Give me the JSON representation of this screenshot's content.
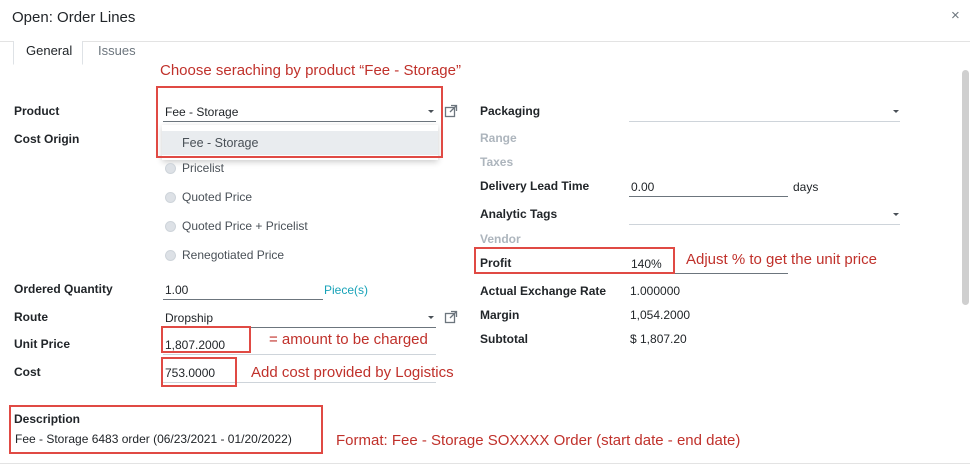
{
  "dialog": {
    "title": "Open: Order Lines",
    "close_symbol": "×"
  },
  "tabs": [
    {
      "label": "General"
    },
    {
      "label": "Issues"
    }
  ],
  "left": {
    "product_label": "Product",
    "product_value": "Fee - Storage",
    "product_option": "Fee - Storage",
    "cost_origin_label": "Cost Origin",
    "cost_origin_options": [
      "Pricelist",
      "Quoted Price",
      "Quoted Price + Pricelist",
      "Renegotiated Price"
    ],
    "ordered_qty_label": "Ordered Quantity",
    "ordered_qty_value": "1.00",
    "uom_value": "Piece(s)",
    "route_label": "Route",
    "route_value": "Dropship",
    "unit_price_label": "Unit Price",
    "unit_price_value": "1,807.2000",
    "cost_label": "Cost",
    "cost_value": "753.0000",
    "description_label": "Description",
    "description_value": "Fee - Storage 6483 order (06/23/2021 - 01/20/2022)"
  },
  "right": {
    "packaging_label": "Packaging",
    "range_label": "Range",
    "taxes_label": "Taxes",
    "lead_time_label": "Delivery Lead Time",
    "lead_time_value": "0.00",
    "lead_time_unit": "days",
    "analytic_tags_label": "Analytic Tags",
    "vendor_label": "Vendor",
    "profit_label": "Profit",
    "profit_value": "140%",
    "exchange_rate_label": "Actual Exchange Rate",
    "exchange_rate_value": "1.000000",
    "margin_label": "Margin",
    "margin_value": "1,054.2000",
    "subtotal_label": "Subtotal",
    "subtotal_value": "$ 1,807.20"
  },
  "annotations": {
    "search": "Choose seraching by product “Fee - Storage”",
    "profit": "Adjust % to get the unit price",
    "unit_price": "= amount to be charged",
    "cost": "Add cost provided by Logistics",
    "description": "Format: Fee - Storage SOXXXX Order (start date - end date)"
  },
  "colors": {
    "annotation": "#e04a44",
    "uom": "#17a2b8"
  }
}
